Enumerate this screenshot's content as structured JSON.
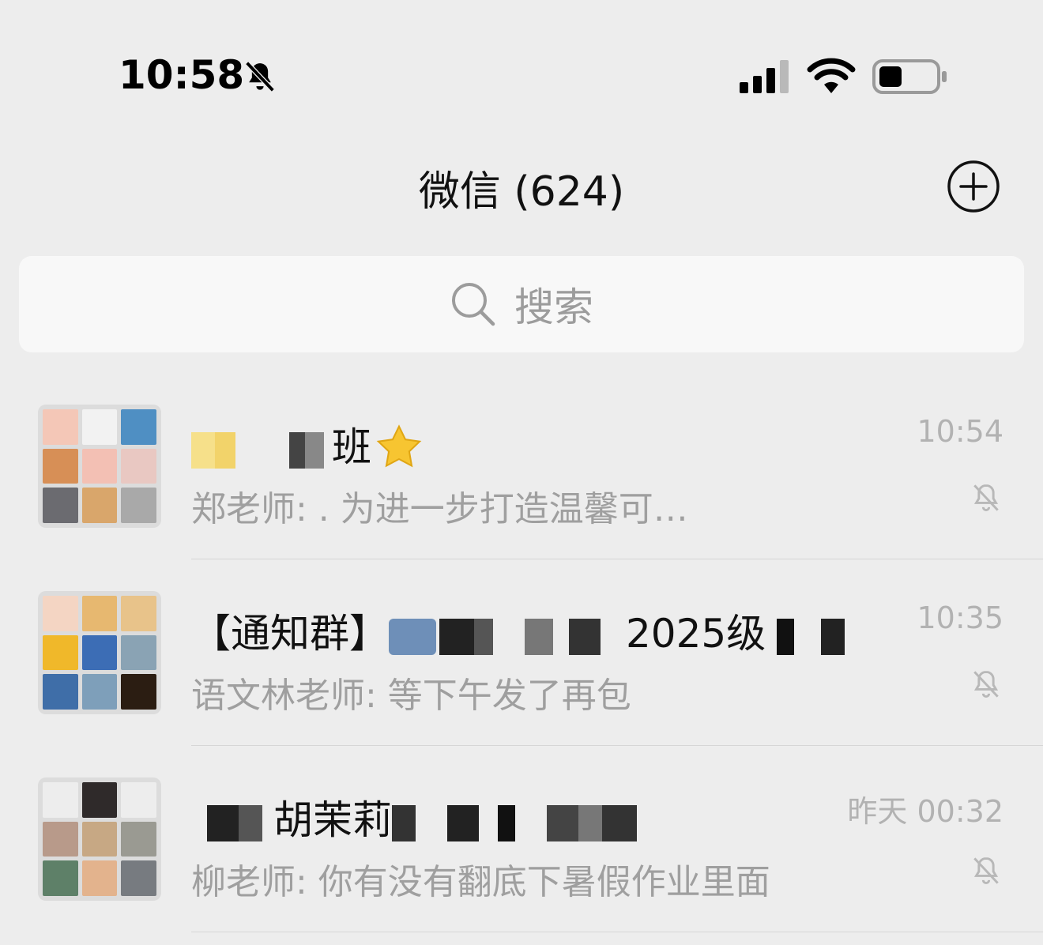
{
  "status_bar": {
    "time": "10:58",
    "icons": [
      "bell-slash-icon",
      "cellular-signal-icon",
      "wifi-icon",
      "battery-icon"
    ]
  },
  "nav": {
    "title": "微信 (624)",
    "right_action_icon": "plus-circle-icon"
  },
  "search": {
    "placeholder": "搜索"
  },
  "chats": [
    {
      "name_visible": "班",
      "time": "10:54",
      "preview": "郑老师: . 为进一步打造温馨可…",
      "muted": true,
      "avatar_colors": [
        "#f4c7b7",
        "#f2f2f2",
        "#4f8fc3",
        "#d78f56",
        "#f3c0b4",
        "#e9c8c2",
        "#6b6b70",
        "#d9a66b",
        "#a9a9a9"
      ]
    },
    {
      "name_prefix": "【通知群】",
      "name_visible": "2025级",
      "time": "10:35",
      "preview": "语文林老师: 等下午发了再包",
      "muted": true,
      "avatar_colors": [
        "#f4d5c3",
        "#e7b870",
        "#e8c38a",
        "#f0b82a",
        "#3c6db5",
        "#8aa3b4",
        "#3f6ea8",
        "#7e9fba",
        "#2b1d12"
      ]
    },
    {
      "name_visible": "胡茉莉",
      "time": "昨天 00:32",
      "preview": "柳老师: 你有没有翻底下暑假作业里面",
      "muted": true,
      "avatar_colors": [
        "#ededed",
        "#2f2a2a",
        "#ededed",
        "#b89a8a",
        "#c7a884",
        "#9a9a92",
        "#5e8068",
        "#e3b38d",
        "#777b80"
      ]
    }
  ],
  "colors": {
    "background": "#ededed",
    "search_bg": "#f8f8f8",
    "secondary_text": "#9f9f9f",
    "time_text": "#b2b2b2"
  }
}
